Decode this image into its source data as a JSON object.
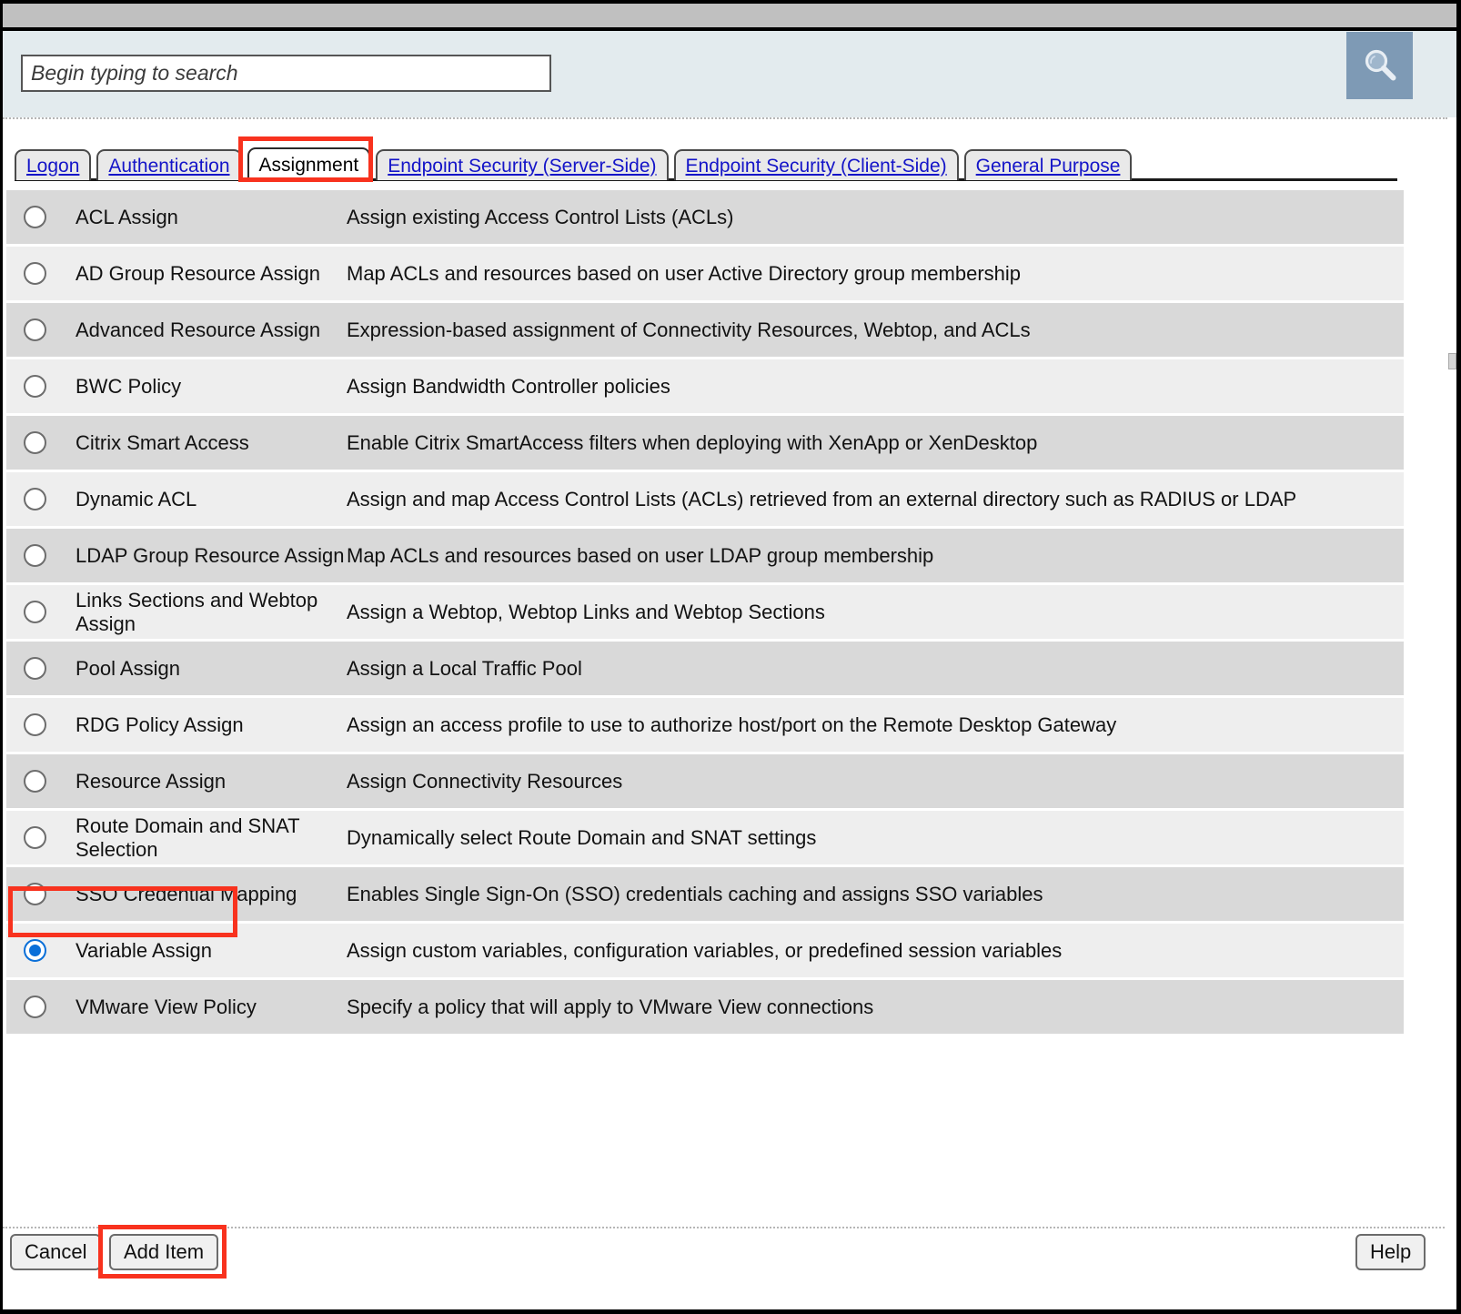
{
  "window": {
    "titlebar_label": ""
  },
  "search": {
    "placeholder": "Begin typing to search",
    "value": "",
    "button_icon": "search-icon"
  },
  "tabs": [
    {
      "label": "Logon",
      "active": false
    },
    {
      "label": "Authentication",
      "active": false
    },
    {
      "label": "Assignment",
      "active": true
    },
    {
      "label": "Endpoint Security (Server-Side)",
      "active": false
    },
    {
      "label": "Endpoint Security (Client-Side)",
      "active": false
    },
    {
      "label": "General Purpose",
      "active": false
    }
  ],
  "items": [
    {
      "name": "ACL Assign",
      "description": "Assign existing Access Control Lists (ACLs)",
      "selected": false
    },
    {
      "name": "AD Group Resource Assign",
      "description": "Map ACLs and resources based on user Active Directory group membership",
      "selected": false
    },
    {
      "name": "Advanced Resource Assign",
      "description": "Expression-based assignment of Connectivity Resources, Webtop, and ACLs",
      "selected": false
    },
    {
      "name": "BWC Policy",
      "description": "Assign Bandwidth Controller policies",
      "selected": false
    },
    {
      "name": "Citrix Smart Access",
      "description": "Enable Citrix SmartAccess filters when deploying with XenApp or XenDesktop",
      "selected": false
    },
    {
      "name": "Dynamic ACL",
      "description": "Assign and map Access Control Lists (ACLs) retrieved from an external directory such as RADIUS or LDAP",
      "selected": false
    },
    {
      "name": "LDAP Group Resource Assign",
      "description": "Map ACLs and resources based on user LDAP group membership",
      "selected": false
    },
    {
      "name": "Links Sections and Webtop Assign",
      "description": "Assign a Webtop, Webtop Links and Webtop Sections",
      "selected": false
    },
    {
      "name": "Pool Assign",
      "description": "Assign a Local Traffic Pool",
      "selected": false
    },
    {
      "name": "RDG Policy Assign",
      "description": "Assign an access profile to use to authorize host/port on the Remote Desktop Gateway",
      "selected": false
    },
    {
      "name": "Resource Assign",
      "description": "Assign Connectivity Resources",
      "selected": false
    },
    {
      "name": "Route Domain and SNAT Selection",
      "description": "Dynamically select Route Domain and SNAT settings",
      "selected": false
    },
    {
      "name": "SSO Credential Mapping",
      "description": "Enables Single Sign-On (SSO) credentials caching and assigns SSO variables",
      "selected": false
    },
    {
      "name": "Variable Assign",
      "description": "Assign custom variables, configuration variables, or predefined session variables",
      "selected": true
    },
    {
      "name": "VMware View Policy",
      "description": "Specify a policy that will apply to VMware View connections",
      "selected": false
    }
  ],
  "footer": {
    "cancel_label": "Cancel",
    "add_item_label": "Add Item",
    "help_label": "Help"
  },
  "colors": {
    "highlight": "#f8321e",
    "selected_radio": "#0a6fd8",
    "link": "#1414c8",
    "row_odd": "#d9d9d9",
    "row_even": "#eeeeee",
    "search_band": "#e3ebee",
    "search_button": "#7e9ab5",
    "titlebar": "#c0c0c0"
  }
}
